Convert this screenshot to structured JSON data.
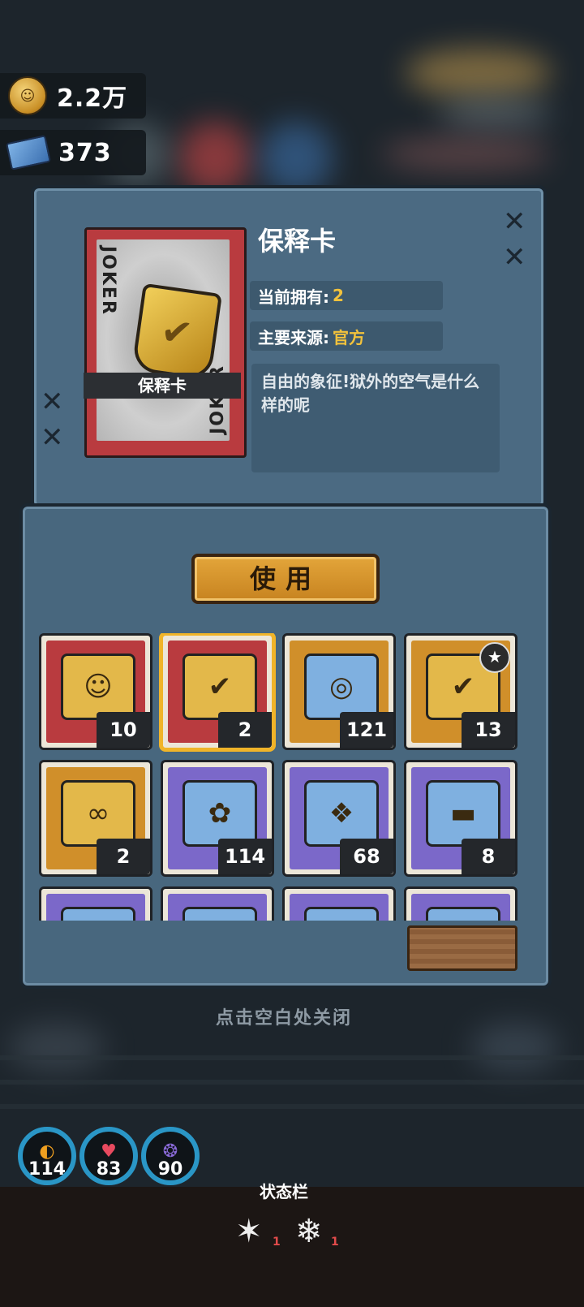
{
  "currency": {
    "coins": "2.2万",
    "tickets": "373"
  },
  "detail": {
    "title": "保释卡",
    "card_label": "保释卡",
    "card_side_text": "JOKER",
    "owned_label": "当前拥有:",
    "owned_value": "2",
    "source_label": "主要来源:",
    "source_value": "官方",
    "description": "自由的象征!狱外的空气是什么样的呢"
  },
  "use_button": "使用",
  "inventory": [
    {
      "count": "10",
      "bg": "#b93b3f",
      "icon": "id-card-icon",
      "selected": false,
      "star": false
    },
    {
      "count": "2",
      "bg": "#b93b3f",
      "icon": "bail-card-icon",
      "selected": true,
      "star": false
    },
    {
      "count": "121",
      "bg": "#d08f2a",
      "icon": "film-reel-icon",
      "selected": false,
      "star": false
    },
    {
      "count": "13",
      "bg": "#d08f2a",
      "icon": "bail-card-star-icon",
      "selected": false,
      "star": true
    },
    {
      "count": "2",
      "bg": "#d08f2a",
      "icon": "golden-card-icon",
      "selected": false,
      "star": false
    },
    {
      "count": "114",
      "bg": "#7b68c9",
      "icon": "toy-ticket-icon",
      "selected": false,
      "star": false
    },
    {
      "count": "68",
      "bg": "#7b68c9",
      "icon": "blue-ticket-icon",
      "selected": false,
      "star": false
    },
    {
      "count": "8",
      "bg": "#7b68c9",
      "icon": "sunglasses-map-icon",
      "selected": false,
      "star": false
    },
    {
      "count": "",
      "bg": "#7b68c9",
      "icon": "bottle-icon",
      "selected": false,
      "star": false
    },
    {
      "count": "",
      "bg": "#7b68c9",
      "icon": "item-icon",
      "selected": false,
      "star": false
    },
    {
      "count": "",
      "bg": "#7b68c9",
      "icon": "item-icon",
      "selected": false,
      "star": false
    },
    {
      "count": "",
      "bg": "#7b68c9",
      "icon": "item-icon",
      "selected": false,
      "star": false
    }
  ],
  "close_hint": "点击空白处关闭",
  "stats": {
    "hunger": "114",
    "health": "83",
    "sanity": "90"
  },
  "status_bar": {
    "title": "状态栏",
    "effect_1_count": "1",
    "effect_2_count": "1"
  }
}
